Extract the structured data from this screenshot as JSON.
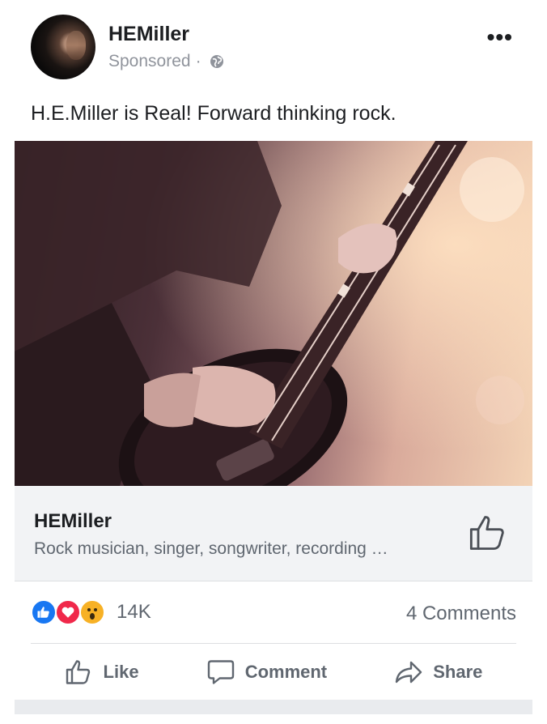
{
  "post": {
    "author": "HEMiller",
    "sponsored_label": "Sponsored",
    "separator": "·",
    "privacy_icon": "globe-icon",
    "more_label": "•••",
    "caption": "H.E.Miller is Real! Forward thinking rock."
  },
  "link_preview": {
    "title": "HEMiller",
    "description": "Rock musician, singer, songwriter, recording …",
    "like_icon": "thumbs-up-outline-icon"
  },
  "engagement": {
    "reactions": [
      "like",
      "love",
      "wow"
    ],
    "reaction_count": "14K",
    "comments": "4 Comments"
  },
  "actions": {
    "like": "Like",
    "comment": "Comment",
    "share": "Share"
  },
  "colors": {
    "like_blue": "#1877f2",
    "love_red": "#f0284a",
    "wow_yellow": "#f7b125",
    "muted_text": "#606770",
    "preview_bg": "#f2f3f5"
  }
}
